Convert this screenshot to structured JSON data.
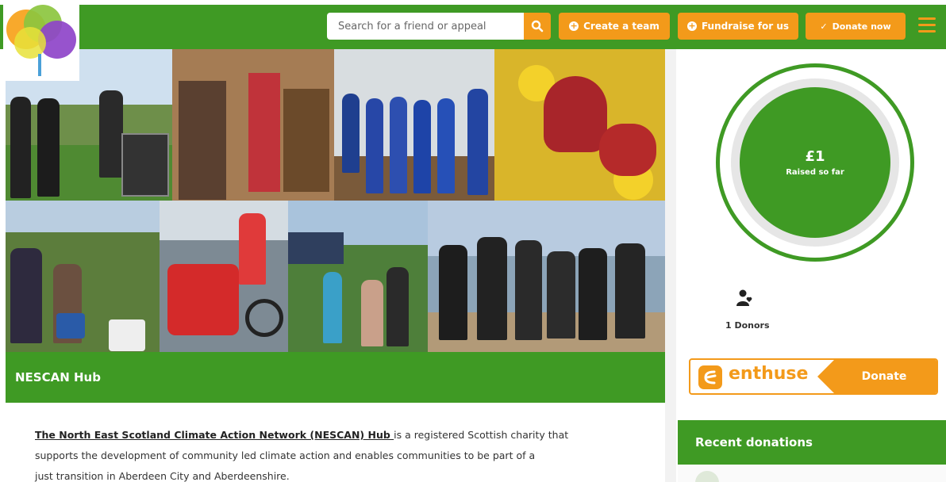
{
  "header": {
    "search_placeholder": "Search for a friend or appeal",
    "create_team": "Create a team",
    "fundraise": "Fundraise for us",
    "donate_now": "Donate now"
  },
  "page": {
    "title": "NESCAN Hub",
    "description_link": "The North East Scotland Climate Action Network (NESCAN) Hub ",
    "description_line1": "is a registered Scottish charity that",
    "description_line2": "supports the development of community led climate action and enables communities to be part of a",
    "description_line3": "just transition in Aberdeen City and Aberdeenshire."
  },
  "sidebar": {
    "amount": "£1",
    "raised_label": "Raised so far",
    "donors": "1 Donors",
    "enthuse_brand": "enthuse",
    "enthuse_donate": "Donate",
    "recent_title": "Recent donations"
  },
  "colors": {
    "brand_green": "#3f9a24",
    "accent_orange": "#f39a1a"
  },
  "icons": [
    "search-icon",
    "plus-circle-icon",
    "check-icon",
    "menu-icon",
    "user-heart-icon",
    "enthuse-logo"
  ]
}
